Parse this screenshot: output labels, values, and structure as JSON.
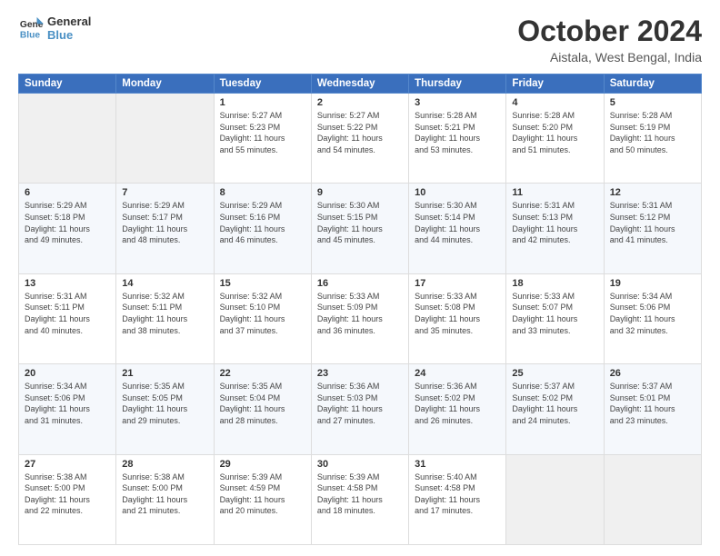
{
  "logo": {
    "line1": "General",
    "line2": "Blue"
  },
  "title": "October 2024",
  "location": "Aistala, West Bengal, India",
  "days_of_week": [
    "Sunday",
    "Monday",
    "Tuesday",
    "Wednesday",
    "Thursday",
    "Friday",
    "Saturday"
  ],
  "weeks": [
    [
      {
        "day": "",
        "info": ""
      },
      {
        "day": "",
        "info": ""
      },
      {
        "day": "1",
        "info": "Sunrise: 5:27 AM\nSunset: 5:23 PM\nDaylight: 11 hours\nand 55 minutes."
      },
      {
        "day": "2",
        "info": "Sunrise: 5:27 AM\nSunset: 5:22 PM\nDaylight: 11 hours\nand 54 minutes."
      },
      {
        "day": "3",
        "info": "Sunrise: 5:28 AM\nSunset: 5:21 PM\nDaylight: 11 hours\nand 53 minutes."
      },
      {
        "day": "4",
        "info": "Sunrise: 5:28 AM\nSunset: 5:20 PM\nDaylight: 11 hours\nand 51 minutes."
      },
      {
        "day": "5",
        "info": "Sunrise: 5:28 AM\nSunset: 5:19 PM\nDaylight: 11 hours\nand 50 minutes."
      }
    ],
    [
      {
        "day": "6",
        "info": "Sunrise: 5:29 AM\nSunset: 5:18 PM\nDaylight: 11 hours\nand 49 minutes."
      },
      {
        "day": "7",
        "info": "Sunrise: 5:29 AM\nSunset: 5:17 PM\nDaylight: 11 hours\nand 48 minutes."
      },
      {
        "day": "8",
        "info": "Sunrise: 5:29 AM\nSunset: 5:16 PM\nDaylight: 11 hours\nand 46 minutes."
      },
      {
        "day": "9",
        "info": "Sunrise: 5:30 AM\nSunset: 5:15 PM\nDaylight: 11 hours\nand 45 minutes."
      },
      {
        "day": "10",
        "info": "Sunrise: 5:30 AM\nSunset: 5:14 PM\nDaylight: 11 hours\nand 44 minutes."
      },
      {
        "day": "11",
        "info": "Sunrise: 5:31 AM\nSunset: 5:13 PM\nDaylight: 11 hours\nand 42 minutes."
      },
      {
        "day": "12",
        "info": "Sunrise: 5:31 AM\nSunset: 5:12 PM\nDaylight: 11 hours\nand 41 minutes."
      }
    ],
    [
      {
        "day": "13",
        "info": "Sunrise: 5:31 AM\nSunset: 5:11 PM\nDaylight: 11 hours\nand 40 minutes."
      },
      {
        "day": "14",
        "info": "Sunrise: 5:32 AM\nSunset: 5:11 PM\nDaylight: 11 hours\nand 38 minutes."
      },
      {
        "day": "15",
        "info": "Sunrise: 5:32 AM\nSunset: 5:10 PM\nDaylight: 11 hours\nand 37 minutes."
      },
      {
        "day": "16",
        "info": "Sunrise: 5:33 AM\nSunset: 5:09 PM\nDaylight: 11 hours\nand 36 minutes."
      },
      {
        "day": "17",
        "info": "Sunrise: 5:33 AM\nSunset: 5:08 PM\nDaylight: 11 hours\nand 35 minutes."
      },
      {
        "day": "18",
        "info": "Sunrise: 5:33 AM\nSunset: 5:07 PM\nDaylight: 11 hours\nand 33 minutes."
      },
      {
        "day": "19",
        "info": "Sunrise: 5:34 AM\nSunset: 5:06 PM\nDaylight: 11 hours\nand 32 minutes."
      }
    ],
    [
      {
        "day": "20",
        "info": "Sunrise: 5:34 AM\nSunset: 5:06 PM\nDaylight: 11 hours\nand 31 minutes."
      },
      {
        "day": "21",
        "info": "Sunrise: 5:35 AM\nSunset: 5:05 PM\nDaylight: 11 hours\nand 29 minutes."
      },
      {
        "day": "22",
        "info": "Sunrise: 5:35 AM\nSunset: 5:04 PM\nDaylight: 11 hours\nand 28 minutes."
      },
      {
        "day": "23",
        "info": "Sunrise: 5:36 AM\nSunset: 5:03 PM\nDaylight: 11 hours\nand 27 minutes."
      },
      {
        "day": "24",
        "info": "Sunrise: 5:36 AM\nSunset: 5:02 PM\nDaylight: 11 hours\nand 26 minutes."
      },
      {
        "day": "25",
        "info": "Sunrise: 5:37 AM\nSunset: 5:02 PM\nDaylight: 11 hours\nand 24 minutes."
      },
      {
        "day": "26",
        "info": "Sunrise: 5:37 AM\nSunset: 5:01 PM\nDaylight: 11 hours\nand 23 minutes."
      }
    ],
    [
      {
        "day": "27",
        "info": "Sunrise: 5:38 AM\nSunset: 5:00 PM\nDaylight: 11 hours\nand 22 minutes."
      },
      {
        "day": "28",
        "info": "Sunrise: 5:38 AM\nSunset: 5:00 PM\nDaylight: 11 hours\nand 21 minutes."
      },
      {
        "day": "29",
        "info": "Sunrise: 5:39 AM\nSunset: 4:59 PM\nDaylight: 11 hours\nand 20 minutes."
      },
      {
        "day": "30",
        "info": "Sunrise: 5:39 AM\nSunset: 4:58 PM\nDaylight: 11 hours\nand 18 minutes."
      },
      {
        "day": "31",
        "info": "Sunrise: 5:40 AM\nSunset: 4:58 PM\nDaylight: 11 hours\nand 17 minutes."
      },
      {
        "day": "",
        "info": ""
      },
      {
        "day": "",
        "info": ""
      }
    ]
  ]
}
